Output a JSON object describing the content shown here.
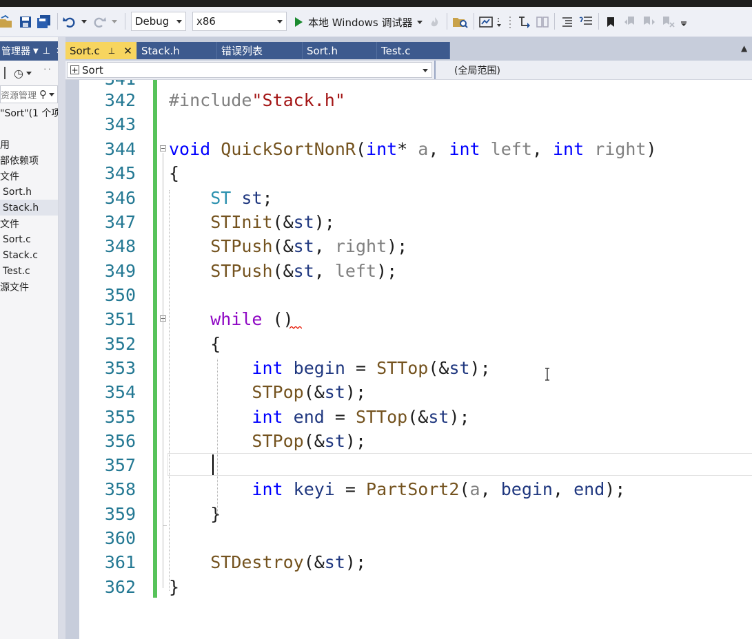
{
  "toolbar": {
    "config": "Debug",
    "platform": "x86",
    "run_label": "本地 Windows 调试器"
  },
  "explorer": {
    "title": "管理器",
    "search_placeholder": "资源管理",
    "solution": "\"Sort\"(1 个项",
    "items": [
      {
        "label": "用"
      },
      {
        "label": "部依赖项"
      },
      {
        "label": "文件"
      },
      {
        "label": "Sort.h"
      },
      {
        "label": "Stack.h"
      },
      {
        "label": "文件"
      },
      {
        "label": "Sort.c"
      },
      {
        "label": "Stack.c"
      },
      {
        "label": "Test.c"
      },
      {
        "label": "源文件"
      }
    ]
  },
  "tabs": [
    {
      "label": "Sort.c",
      "active": true
    },
    {
      "label": "Stack.h"
    },
    {
      "label": "错误列表"
    },
    {
      "label": "Sort.h"
    },
    {
      "label": "Test.c"
    }
  ],
  "navbar": {
    "scope_left": "Sort",
    "scope_right": "(全局范围)"
  },
  "editor": {
    "top_partial_line": "341",
    "lines": [
      {
        "n": "342",
        "code": "#include\"Stack.h\""
      },
      {
        "n": "343",
        "code": ""
      },
      {
        "n": "344",
        "code": "void QuickSortNonR(int* a, int left, int right)"
      },
      {
        "n": "345",
        "code": "{"
      },
      {
        "n": "346",
        "code": "    ST st;"
      },
      {
        "n": "347",
        "code": "    STInit(&st);"
      },
      {
        "n": "348",
        "code": "    STPush(&st, right);"
      },
      {
        "n": "349",
        "code": "    STPush(&st, left);"
      },
      {
        "n": "350",
        "code": ""
      },
      {
        "n": "351",
        "code": "    while ()"
      },
      {
        "n": "352",
        "code": "    {"
      },
      {
        "n": "353",
        "code": "        int begin = STTop(&st);"
      },
      {
        "n": "354",
        "code": "        STPop(&st);"
      },
      {
        "n": "355",
        "code": "        int end = STTop(&st);"
      },
      {
        "n": "356",
        "code": "        STPop(&st);"
      },
      {
        "n": "357",
        "code": ""
      },
      {
        "n": "358",
        "code": "        int keyi = PartSort2(a, begin, end);"
      },
      {
        "n": "359",
        "code": "    }"
      },
      {
        "n": "360",
        "code": ""
      },
      {
        "n": "361",
        "code": "    STDestroy(&st);"
      },
      {
        "n": "362",
        "code": "}"
      }
    ]
  }
}
